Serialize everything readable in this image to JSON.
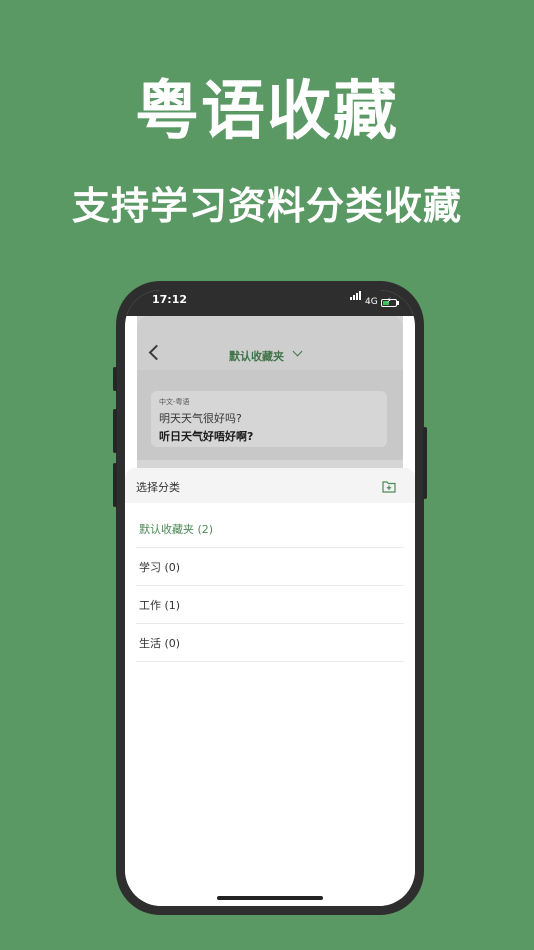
{
  "promo": {
    "headline": "粤语收藏",
    "subline": "支持学习资料分类收藏"
  },
  "status_bar": {
    "time": "17:12",
    "network": "4G",
    "icons": [
      "signal-icon",
      "battery-charging-icon"
    ]
  },
  "navbar": {
    "back_icon": "chevron-left-icon",
    "folder_title": "默认收藏夹",
    "dropdown_icon": "chevron-down-icon"
  },
  "favorite_card": {
    "language_pair": "中文-粤语",
    "source_text": "明天天气很好吗?",
    "target_text": "听日天气好唔好啊?"
  },
  "category_sheet": {
    "title": "选择分类",
    "add_icon": "add-folder-icon",
    "items": [
      {
        "label": "默认收藏夹 (2)",
        "selected": true
      },
      {
        "label": "学习 (0)",
        "selected": false
      },
      {
        "label": "工作 (1)",
        "selected": false
      },
      {
        "label": "生活 (0)",
        "selected": false
      }
    ]
  },
  "colors": {
    "background": "#5a9864",
    "accent": "#4c8a56",
    "phone_frame": "#2e2e2e"
  }
}
